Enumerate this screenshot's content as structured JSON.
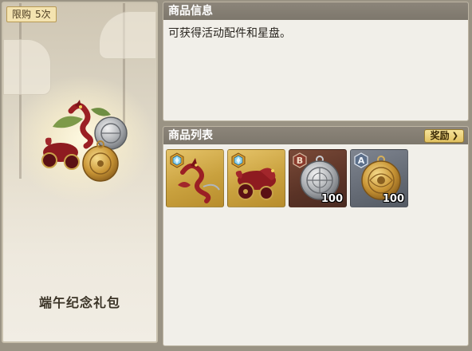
{
  "gift": {
    "limit_label": "限购",
    "limit_count": "5次",
    "title": "端午纪念礼包"
  },
  "info": {
    "header": "商品信息",
    "description": "可获得活动配件和星盘。"
  },
  "list": {
    "header": "商品列表",
    "reward_button": "奖励",
    "reward_chevron": "❯",
    "items": [
      {
        "icon": "red-dragon-icon",
        "grade": "diamond-grade",
        "quantity": ""
      },
      {
        "icon": "red-dragon-chariot-icon",
        "grade": "diamond-grade",
        "quantity": ""
      },
      {
        "icon": "silver-astrolabe-icon",
        "grade": "B",
        "quantity": "100"
      },
      {
        "icon": "gold-astrolabe-icon",
        "grade": "A",
        "quantity": "100"
      }
    ]
  },
  "colors": {
    "header_bg": "#7d776c",
    "panel_bg": "#f1efe9",
    "badge_bg": "#f4e3b0",
    "reward_bg": "#e2c261"
  }
}
